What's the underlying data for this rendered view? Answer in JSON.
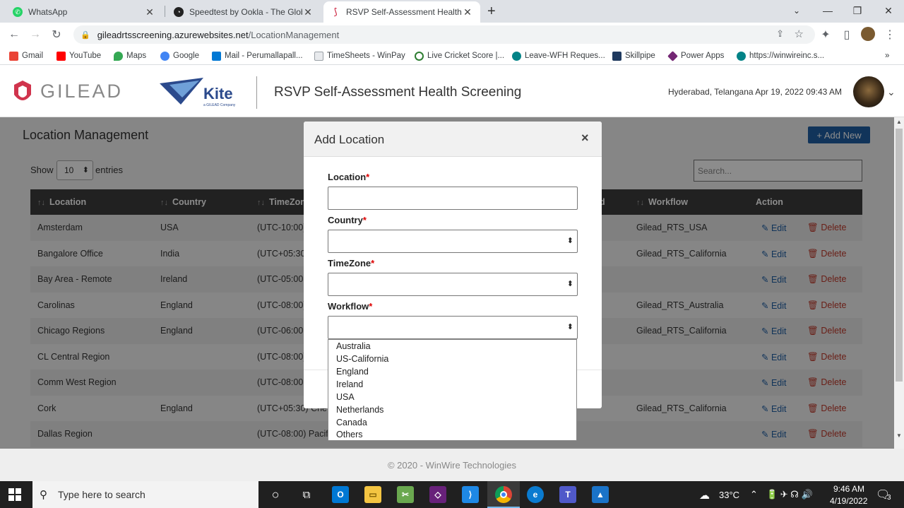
{
  "browser": {
    "tabs": [
      {
        "title": "WhatsApp",
        "active": false,
        "color": "#25d366"
      },
      {
        "title": "Speedtest by Ookla - The Global",
        "active": false,
        "color": "#222222"
      },
      {
        "title": "RSVP Self-Assessment Health Sc",
        "active": true,
        "color": "#c8102e"
      }
    ],
    "new_tab": "+",
    "url_host": "gileadrtsscreening.azurewebsites.net",
    "url_path": "/LocationManagement",
    "bookmarks": [
      {
        "label": "Gmail",
        "color": "#ea4335"
      },
      {
        "label": "YouTube",
        "color": "#ff0000"
      },
      {
        "label": "Maps",
        "color": "#34a853"
      },
      {
        "label": "Google",
        "color": "#4285f4"
      },
      {
        "label": "Mail - Perumallapall...",
        "color": "#0078d4"
      },
      {
        "label": "TimeSheets - WinPay",
        "color": "#5f6368"
      },
      {
        "label": "Live Cricket Score |...",
        "color": "#2e7d32"
      },
      {
        "label": "Leave-WFH Reques...",
        "color": "#038387"
      },
      {
        "label": "Skillpipe",
        "color": "#1f3a5f"
      },
      {
        "label": "Power Apps",
        "color": "#742774"
      },
      {
        "label": "https://winwireinc.s...",
        "color": "#038387"
      }
    ],
    "more_bookmarks": "»"
  },
  "header": {
    "logo_text": "GILEAD",
    "kite_text": "Kite",
    "kite_sub": "a GILEAD Company",
    "app_title": "RSVP Self-Assessment Health Screening",
    "location_datetime": "Hyderabad, Telangana  Apr 19, 2022 09:43 AM"
  },
  "page": {
    "title": "Location Management",
    "add_new_label": "+ Add New",
    "show_label": "Show",
    "entries_value": "10",
    "entries_label": "entries",
    "search_placeholder": "Search...",
    "columns": [
      "Location",
      "Country",
      "TimeZone",
      "d",
      "Workflow",
      "Action"
    ],
    "rows": [
      {
        "location": "Amsterdam",
        "country": "USA",
        "timezone": "(UTC-10:00)",
        "workflow": "Gilead_RTS_USA"
      },
      {
        "location": "Bangalore Office",
        "country": "India",
        "timezone": "(UTC+05:30",
        "workflow": "Gilead_RTS_California"
      },
      {
        "location": "Bay Area - Remote",
        "country": "Ireland",
        "timezone": "(UTC-05:00",
        "workflow": ""
      },
      {
        "location": "Carolinas",
        "country": "England",
        "timezone": "(UTC-08:00)",
        "workflow": "Gilead_RTS_Australia"
      },
      {
        "location": "Chicago Regions",
        "country": "England",
        "timezone": "(UTC-06:00",
        "workflow": "Gilead_RTS_California"
      },
      {
        "location": "CL Central Region",
        "country": "",
        "timezone": "(UTC-08:00)",
        "workflow": ""
      },
      {
        "location": "Comm West Region",
        "country": "",
        "timezone": "(UTC-08:00",
        "workflow": ""
      },
      {
        "location": "Cork",
        "country": "England",
        "timezone": "(UTC+05:30) Che",
        "workflow": "Gilead_RTS_California"
      },
      {
        "location": "Dallas Region",
        "country": "",
        "timezone": "(UTC-08:00) Pacif",
        "workflow": ""
      }
    ],
    "edit_label": "Edit",
    "delete_label": "Delete"
  },
  "modal": {
    "title": "Add Location",
    "close": "×",
    "fields": [
      {
        "label": "Location",
        "required": "*"
      },
      {
        "label": "Country",
        "required": "*"
      },
      {
        "label": "TimeZone",
        "required": "*"
      },
      {
        "label": "Workflow",
        "required": "*"
      }
    ],
    "workflow_options": [
      "Australia",
      "US-California",
      "England",
      "Ireland",
      "USA",
      "Netherlands",
      "Canada",
      "Others"
    ]
  },
  "footer": {
    "text": "© 2020 - WinWire Technologies"
  },
  "taskbar": {
    "search_placeholder": "Type here to search",
    "temperature": "33°C",
    "time": "9:46 AM",
    "date": "4/19/2022",
    "notification_count": "3"
  },
  "colors": {
    "accent": "#1f5fa5",
    "delete": "#c0392b",
    "table_header": "#3c3c3c"
  }
}
